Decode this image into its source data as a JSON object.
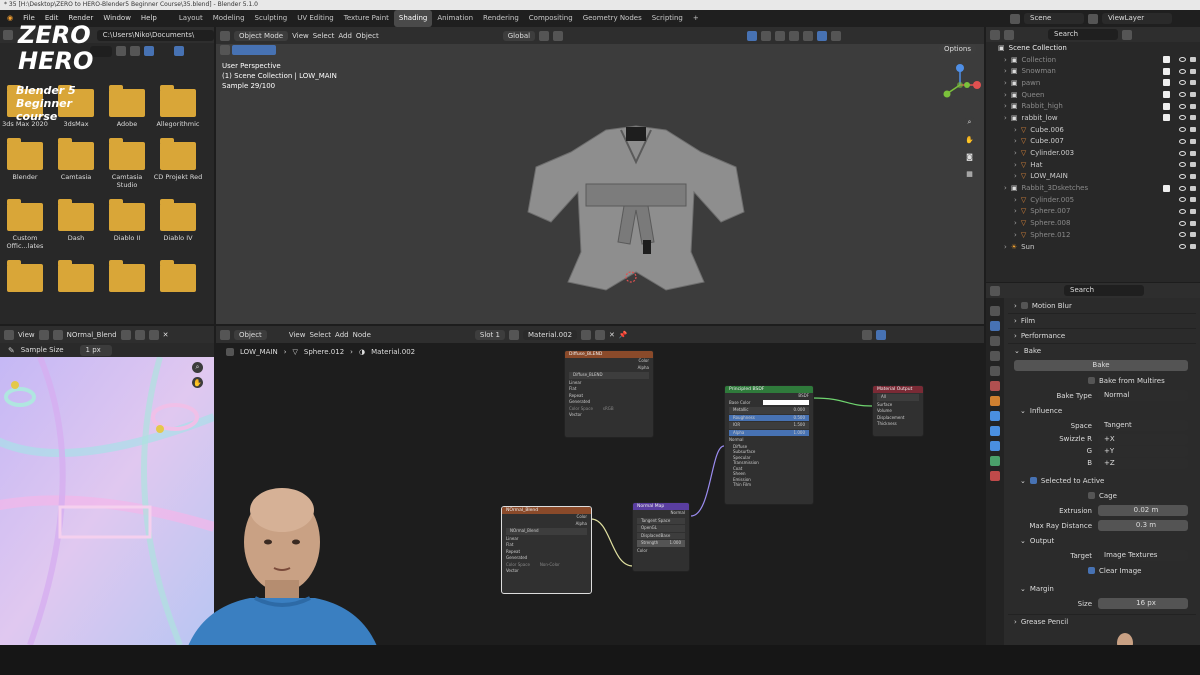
{
  "window": {
    "title": "* 35 [H:\\Desktop\\ZERO to HERO-Blender5 Beginner Course\\35.blend] - Blender 5.1.0"
  },
  "menu": {
    "items": [
      "File",
      "Edit",
      "Render",
      "Window",
      "Help"
    ]
  },
  "workspaces": {
    "tabs": [
      "Layout",
      "Modeling",
      "Sculpting",
      "UV Editing",
      "Texture Paint",
      "Shading",
      "Animation",
      "Rendering",
      "Compositing",
      "Geometry Nodes",
      "Scripting"
    ],
    "active": "Shading",
    "add": "+"
  },
  "topright": {
    "scene": "Scene",
    "viewlayer": "ViewLayer"
  },
  "logo": {
    "line1": "ZERO",
    "line2": "HERO",
    "line3": "Blender 5",
    "line4": "Beginner",
    "line5": "course"
  },
  "filebrowser": {
    "path": "C:\\Users\\Niko\\Documents\\",
    "folders": [
      "3ds Max 2020",
      "3dsMax",
      "Adobe",
      "Allegorithmic",
      "Blender",
      "Camtasia",
      "Camtasia Studio",
      "CD Projekt Red",
      "Custom Offic...lates",
      "Dash",
      "Diablo II",
      "Diablo IV",
      "",
      "",
      "",
      ""
    ]
  },
  "viewport": {
    "mode": "Object Mode",
    "menus": [
      "View",
      "Select",
      "Add",
      "Object"
    ],
    "transform": "Global",
    "info1": "User Perspective",
    "info2": "(1) Scene Collection | LOW_MAIN",
    "info3": "Sample 29/100",
    "options": "Options"
  },
  "outliner": {
    "search": "Search",
    "root": "Scene Collection",
    "rows": [
      {
        "name": "Collection",
        "dim": true,
        "indent": 1
      },
      {
        "name": "Snowman",
        "dim": true,
        "indent": 1
      },
      {
        "name": "pawn",
        "dim": true,
        "indent": 1
      },
      {
        "name": "Queen",
        "dim": true,
        "indent": 1
      },
      {
        "name": "Rabbit_high",
        "dim": true,
        "indent": 1
      },
      {
        "name": "rabbit_low",
        "dim": false,
        "indent": 1
      },
      {
        "name": "Cube.006",
        "dim": false,
        "indent": 2
      },
      {
        "name": "Cube.007",
        "dim": false,
        "indent": 2
      },
      {
        "name": "Cylinder.003",
        "dim": false,
        "indent": 2
      },
      {
        "name": "Hat",
        "dim": false,
        "indent": 2
      },
      {
        "name": "LOW_MAIN",
        "dim": false,
        "indent": 2
      },
      {
        "name": "Rabbit_3Dsketches",
        "dim": true,
        "indent": 1
      },
      {
        "name": "Cylinder.005",
        "dim": true,
        "indent": 2
      },
      {
        "name": "Sphere.007",
        "dim": true,
        "indent": 2
      },
      {
        "name": "Sphere.008",
        "dim": true,
        "indent": 2
      },
      {
        "name": "Sphere.012",
        "dim": true,
        "indent": 2
      },
      {
        "name": "Sun",
        "dim": false,
        "indent": 1
      }
    ]
  },
  "imageeditor": {
    "view": "View",
    "image": "NOrmal_Blend",
    "sample_label": "Sample Size",
    "sample_value": "1 px"
  },
  "nodeeditor": {
    "menus": [
      "Object",
      "View",
      "Select",
      "Add",
      "Node"
    ],
    "slot": "Slot 1",
    "material": "Material.002",
    "breadcrumb": [
      "LOW_MAIN",
      "Sphere.012",
      "Material.002"
    ],
    "node_diffuse": {
      "title": "Diffuse_BLEND",
      "rows": [
        "Color",
        "Alpha"
      ],
      "image": "Diffuse_BLEND",
      "opts": [
        "Linear",
        "Flat",
        "Repeat",
        "Generated"
      ],
      "cs": "Color Space",
      "cs_val": "sRGB",
      "vector": "Vector"
    },
    "node_normal_img": {
      "title": "NOrmal_Blend",
      "rows": [
        "Color",
        "Alpha"
      ],
      "image": "NOrmal_Blend",
      "opts": [
        "Linear",
        "Flat",
        "Repeat",
        "Generated"
      ],
      "cs": "Color Space",
      "cs_val": "Non-Color",
      "vector": "Vector"
    },
    "node_normalmap": {
      "title": "Normal Map",
      "out": "Normal",
      "opts": [
        "Tangent Space",
        "OpenGL",
        "DisplacedBase"
      ],
      "strength_label": "Strength",
      "strength_val": "1.000",
      "color": "Color"
    },
    "node_bsdf": {
      "title": "Principled BSDF",
      "out": "BSDF",
      "base": "Base Color",
      "metallic": "Metallic",
      "metallic_val": "0.000",
      "rough": "Roughness",
      "rough_val": "0.500",
      "ior": "IOR",
      "ior_val": "1.500",
      "alpha": "Alpha",
      "alpha_val": "1.000",
      "normal": "Normal",
      "subs": [
        "Diffuse",
        "Subsurface",
        "Specular",
        "Transmission",
        "Coat",
        "Sheen",
        "Emission",
        "Thin Film"
      ]
    },
    "node_output": {
      "title": "Material Output",
      "target": "All",
      "rows": [
        "Surface",
        "Volume",
        "Displacement",
        "Thickness"
      ]
    }
  },
  "properties": {
    "search": "Search",
    "motion_blur": "Motion Blur",
    "film": "Film",
    "performance": "Performance",
    "bake": "Bake",
    "bake_button": "Bake",
    "bake_multires": "Bake from Multires",
    "bake_type_label": "Bake Type",
    "bake_type": "Normal",
    "influence": "Influence",
    "space_label": "Space",
    "space": "Tangent",
    "swizzle_label": "Swizzle R",
    "swizzle_r": "+X",
    "g_label": "G",
    "swizzle_g": "+Y",
    "b_label": "B",
    "swizzle_b": "+Z",
    "selected_active": "Selected to Active",
    "cage": "Cage",
    "extrusion_label": "Extrusion",
    "extrusion": "0.02 m",
    "raydist_label": "Max Ray Distance",
    "raydist": "0.3 m",
    "output": "Output",
    "target_label": "Target",
    "target": "Image Textures",
    "clear_image": "Clear Image",
    "margin": "Margin",
    "size_label": "Size",
    "size": "16 px",
    "grease": "Grease Pencil"
  },
  "colors": {
    "accent": "#4772b3",
    "folder": "#d9a638",
    "node_image": "#8a4a2a",
    "node_bsdf": "#2f7a3b",
    "node_output": "#7a2a35",
    "node_vector": "#5a3ea0"
  }
}
